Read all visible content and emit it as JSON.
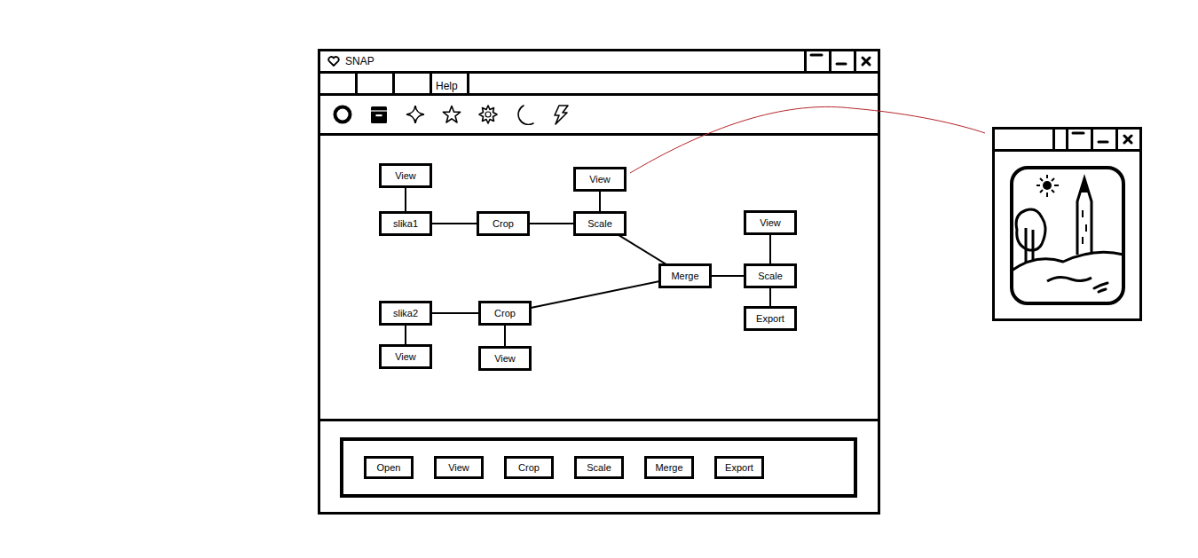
{
  "window": {
    "title": "SNAP"
  },
  "menu": [
    {
      "label": ""
    },
    {
      "label": ""
    },
    {
      "label": ""
    },
    {
      "label": "Help"
    }
  ],
  "canvas": {
    "nodes": [
      {
        "label": "View"
      },
      {
        "label": "slika1"
      },
      {
        "label": "Crop"
      },
      {
        "label": "Scale"
      },
      {
        "label": "View"
      },
      {
        "label": "Merge"
      },
      {
        "label": "Scale"
      },
      {
        "label": "View"
      },
      {
        "label": "Export"
      },
      {
        "label": "slika2"
      },
      {
        "label": "Crop"
      },
      {
        "label": "View"
      },
      {
        "label": "View"
      }
    ],
    "edges": [
      [
        0,
        1
      ],
      [
        1,
        2
      ],
      [
        2,
        3
      ],
      [
        3,
        4
      ],
      [
        3,
        5
      ],
      [
        9,
        10
      ],
      [
        10,
        5
      ],
      [
        9,
        11
      ],
      [
        10,
        12
      ],
      [
        5,
        6
      ],
      [
        6,
        7
      ],
      [
        6,
        8
      ]
    ]
  },
  "palette": [
    "Open",
    "View",
    "Crop",
    "Scale",
    "Merge",
    "Export"
  ],
  "preview_window": {
    "title": ""
  }
}
